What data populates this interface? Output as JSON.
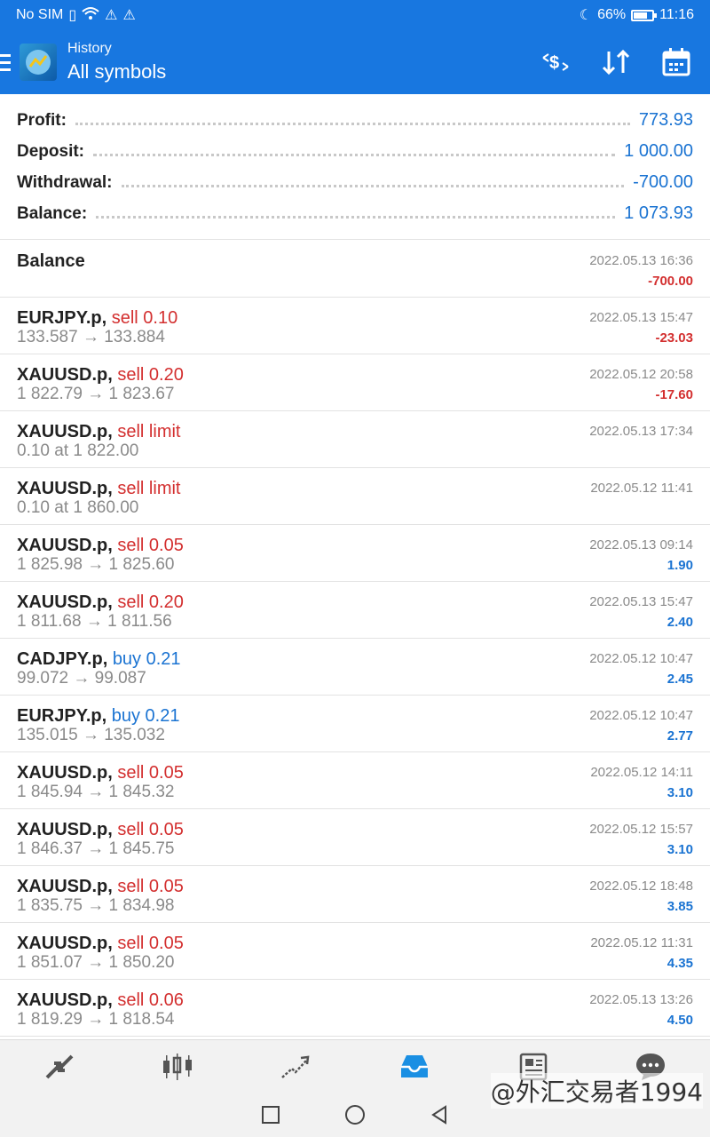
{
  "status_bar": {
    "carrier": "No SIM",
    "battery_percent": "66%",
    "battery_level": 0.66,
    "time": "11:16"
  },
  "toolbar": {
    "subtitle": "History",
    "title": "All symbols"
  },
  "summary": [
    {
      "label": "Profit:",
      "value": "773.93"
    },
    {
      "label": "Deposit:",
      "value": "1 000.00"
    },
    {
      "label": "Withdrawal:",
      "value": "-700.00"
    },
    {
      "label": "Balance:",
      "value": "1 073.93"
    }
  ],
  "balance_entry": {
    "label": "Balance",
    "time": "2022.05.13 16:36",
    "amount": "-700.00"
  },
  "deals": [
    {
      "symbol": "EURJPY.p,",
      "action": "sell 0.10",
      "action_color": "red",
      "prices": "133.587 → 133.884",
      "time": "2022.05.13 15:47",
      "profit": "-23.03",
      "profit_color": "red"
    },
    {
      "symbol": "XAUUSD.p,",
      "action": "sell 0.20",
      "action_color": "red",
      "prices": "1 822.79 → 1 823.67",
      "time": "2022.05.12 20:58",
      "profit": "-17.60",
      "profit_color": "red"
    },
    {
      "symbol": "XAUUSD.p,",
      "action": "sell limit",
      "action_color": "red",
      "prices": "0.10 at 1 822.00",
      "time": "2022.05.13 17:34",
      "profit": "",
      "profit_color": "blue"
    },
    {
      "symbol": "XAUUSD.p,",
      "action": "sell limit",
      "action_color": "red",
      "prices": "0.10 at 1 860.00",
      "time": "2022.05.12 11:41",
      "profit": "",
      "profit_color": "blue"
    },
    {
      "symbol": "XAUUSD.p,",
      "action": "sell 0.05",
      "action_color": "red",
      "prices": "1 825.98 → 1 825.60",
      "time": "2022.05.13 09:14",
      "profit": "1.90",
      "profit_color": "blue"
    },
    {
      "symbol": "XAUUSD.p,",
      "action": "sell 0.20",
      "action_color": "red",
      "prices": "1 811.68 → 1 811.56",
      "time": "2022.05.13 15:47",
      "profit": "2.40",
      "profit_color": "blue"
    },
    {
      "symbol": "CADJPY.p,",
      "action": "buy 0.21",
      "action_color": "blue",
      "prices": "99.072 → 99.087",
      "time": "2022.05.12 10:47",
      "profit": "2.45",
      "profit_color": "blue"
    },
    {
      "symbol": "EURJPY.p,",
      "action": "buy 0.21",
      "action_color": "blue",
      "prices": "135.015 → 135.032",
      "time": "2022.05.12 10:47",
      "profit": "2.77",
      "profit_color": "blue"
    },
    {
      "symbol": "XAUUSD.p,",
      "action": "sell 0.05",
      "action_color": "red",
      "prices": "1 845.94 → 1 845.32",
      "time": "2022.05.12 14:11",
      "profit": "3.10",
      "profit_color": "blue"
    },
    {
      "symbol": "XAUUSD.p,",
      "action": "sell 0.05",
      "action_color": "red",
      "prices": "1 846.37 → 1 845.75",
      "time": "2022.05.12 15:57",
      "profit": "3.10",
      "profit_color": "blue"
    },
    {
      "symbol": "XAUUSD.p,",
      "action": "sell 0.05",
      "action_color": "red",
      "prices": "1 835.75 → 1 834.98",
      "time": "2022.05.12 18:48",
      "profit": "3.85",
      "profit_color": "blue"
    },
    {
      "symbol": "XAUUSD.p,",
      "action": "sell 0.05",
      "action_color": "red",
      "prices": "1 851.07 → 1 850.20",
      "time": "2022.05.12 11:31",
      "profit": "4.35",
      "profit_color": "blue"
    },
    {
      "symbol": "XAUUSD.p,",
      "action": "sell 0.06",
      "action_color": "red",
      "prices": "1 819.29 → 1 818.54",
      "time": "2022.05.13 13:26",
      "profit": "4.50",
      "profit_color": "blue"
    }
  ],
  "bottom_nav": [
    {
      "icon": "quotes-icon",
      "active": false
    },
    {
      "icon": "chart-candles-icon",
      "active": false
    },
    {
      "icon": "trade-icon",
      "active": false
    },
    {
      "icon": "history-inbox-icon",
      "active": true
    },
    {
      "icon": "news-icon",
      "active": false
    },
    {
      "icon": "chat-icon",
      "active": false
    }
  ],
  "watermark": "@外汇交易者1994",
  "colors": {
    "primary": "#1877e0",
    "loss": "#d32f2f",
    "profit": "#1a73d2",
    "muted": "#8a8a8a"
  }
}
